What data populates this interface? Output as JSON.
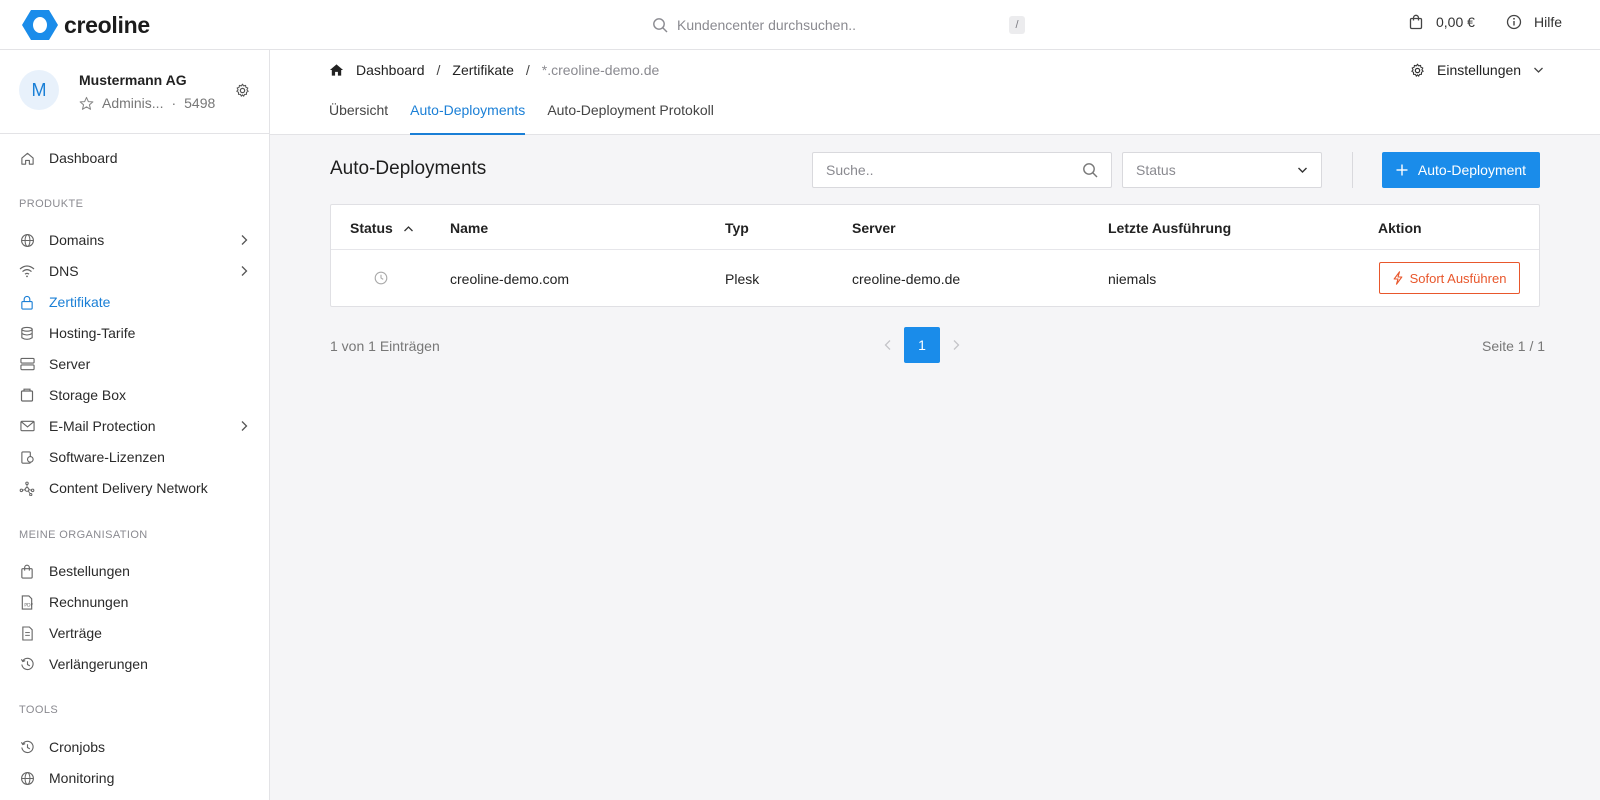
{
  "topbar": {
    "brand": "creoline",
    "search_placeholder": "Kundencenter durchsuchen..",
    "search_shortcut": "/",
    "cart_amount": "0,00 €",
    "help_label": "Hilfe"
  },
  "profile": {
    "initial": "M",
    "company": "Mustermann AG",
    "role": "Adminis...",
    "separator": "·",
    "customer_id": "5498"
  },
  "sidebar": {
    "dashboard": "Dashboard",
    "sections": {
      "products": "PRODUKTE",
      "organisation": "MEINE ORGANISATION",
      "tools": "TOOLS"
    },
    "products": [
      {
        "label": "Domains",
        "icon": "globe-icon"
      },
      {
        "label": "DNS",
        "icon": "wifi-icon"
      },
      {
        "label": "Zertifikate",
        "icon": "lock-icon"
      },
      {
        "label": "Hosting-Tarife",
        "icon": "database-icon"
      },
      {
        "label": "Server",
        "icon": "server-icon"
      },
      {
        "label": "Storage Box",
        "icon": "box-icon"
      },
      {
        "label": "E-Mail Protection",
        "icon": "mail-icon"
      },
      {
        "label": "Software-Lizenzen",
        "icon": "license-icon"
      },
      {
        "label": "Content Delivery Network",
        "icon": "network-icon"
      }
    ],
    "organisation": [
      {
        "label": "Bestellungen",
        "icon": "bag-icon"
      },
      {
        "label": "Rechnungen",
        "icon": "invoice-icon"
      },
      {
        "label": "Verträge",
        "icon": "document-icon"
      },
      {
        "label": "Verlängerungen",
        "icon": "history-icon"
      }
    ],
    "tools": [
      {
        "label": "Cronjobs",
        "icon": "history-icon"
      },
      {
        "label": "Monitoring",
        "icon": "globe-icon"
      }
    ]
  },
  "breadcrumb": {
    "home": "Dashboard",
    "sep": "/",
    "section": "Zertifikate",
    "current": "*.creoline-demo.de"
  },
  "header": {
    "settings_label": "Einstellungen",
    "tabs": [
      "Übersicht",
      "Auto-Deployments",
      "Auto-Deployment Protokoll"
    ]
  },
  "main": {
    "title": "Auto-Deployments",
    "search_placeholder": "Suche..",
    "status_placeholder": "Status",
    "add_button": "Auto-Deployment",
    "columns": [
      "Status",
      "Name",
      "Typ",
      "Server",
      "Letzte Ausführung",
      "Aktion"
    ],
    "rows": [
      {
        "name": "creoline-demo.com",
        "type": "Plesk",
        "server": "creoline-demo.de",
        "last_run": "niemals",
        "action": "Sofort Ausführen"
      }
    ],
    "entries_count": "1 von 1 Einträgen",
    "current_page": "1",
    "page_info": "Seite 1 / 1"
  },
  "colors": {
    "accent": "#1a8cea",
    "active_link": "#1a7fd6",
    "action": "#e8572c"
  }
}
